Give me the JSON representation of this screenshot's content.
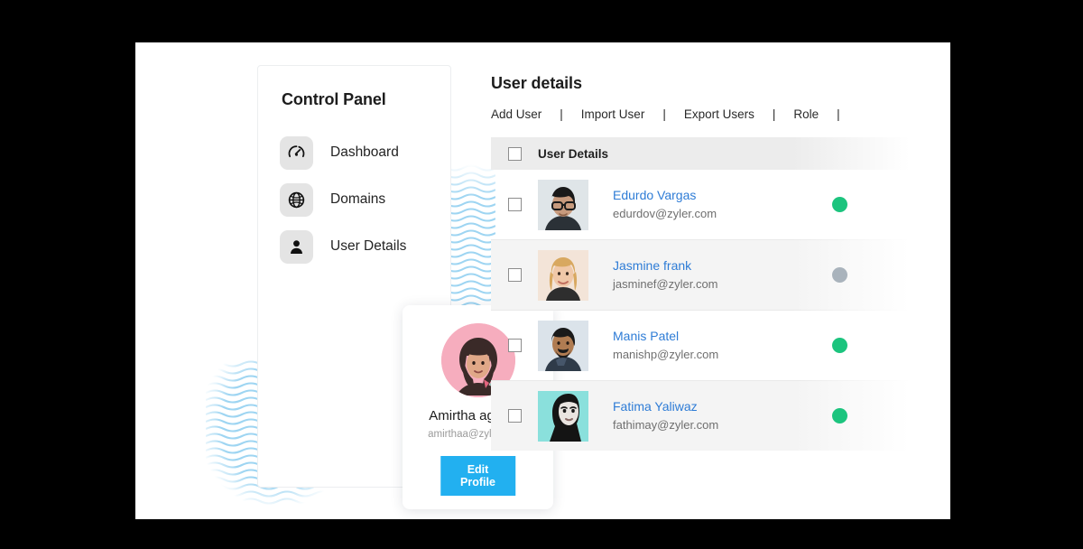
{
  "control_panel": {
    "title": "Control Panel",
    "nav_items": [
      {
        "label": "Dashboard",
        "icon": "speedometer-icon"
      },
      {
        "label": "Domains",
        "icon": "globe-icon"
      },
      {
        "label": "User Details",
        "icon": "person-icon"
      }
    ],
    "profile": {
      "name": "Amirtha agarwal",
      "email": "amirthaa@zylker.com",
      "button_label": "Edit Profile",
      "avatar_bg": "#f6adbe"
    }
  },
  "user_details": {
    "title": "User details",
    "toolbar": [
      {
        "label": "Add User"
      },
      {
        "label": "Import User"
      },
      {
        "label": "Export Users"
      },
      {
        "label": "Role"
      }
    ],
    "separator": "|",
    "table": {
      "header": {
        "column_label": "User Details"
      },
      "rows": [
        {
          "name": "Edurdo Vargas",
          "email": "edurdov@zyler.com",
          "status": "online",
          "status_color": "#1cc47e",
          "avatar_bg": "#dfe5e8",
          "shaded": false
        },
        {
          "name": "Jasmine frank",
          "email": "jasminef@zyler.com",
          "status": "offline",
          "status_color": "#a9b3bc",
          "avatar_bg": "#f3e4d8",
          "shaded": true
        },
        {
          "name": "Manis Patel",
          "email": "manishp@zyler.com",
          "status": "online",
          "status_color": "#1cc47e",
          "avatar_bg": "#dbe3ea",
          "shaded": false
        },
        {
          "name": "Fatima Yaliwaz",
          "email": "fathimay@zyler.com",
          "status": "online",
          "status_color": "#1cc47e",
          "avatar_bg": "#8ae0dc",
          "shaded": true
        }
      ]
    }
  },
  "colors": {
    "accent_blue": "#22b0f0",
    "link_blue": "#2e7cd6",
    "status_green": "#1cc47e",
    "status_gray": "#a9b3bc",
    "wave_blue": "#9ed5f2",
    "frame_black": "#000000"
  }
}
